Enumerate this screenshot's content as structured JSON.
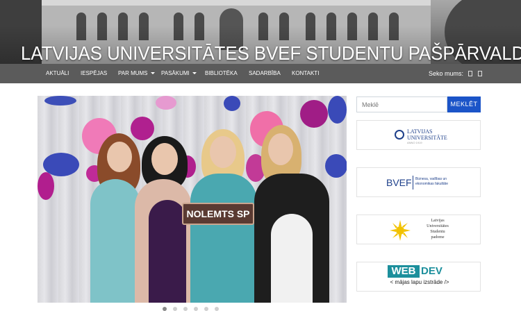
{
  "header": {
    "title": "LATVIJAS UNIVERSITĀTES BVEF STUDENTU PAŠPĀRVALDE"
  },
  "nav": {
    "items": [
      {
        "label": "AKTUĀLI",
        "dropdown": false
      },
      {
        "label": "IESPĒJAS",
        "dropdown": false
      },
      {
        "label": "PAR MUMS",
        "dropdown": true
      },
      {
        "label": "PASĀKUMI",
        "dropdown": true
      },
      {
        "label": "BIBLIOTĒKA",
        "dropdown": false
      },
      {
        "label": "SADARBĪBA",
        "dropdown": false
      },
      {
        "label": "KONTAKTI",
        "dropdown": false
      }
    ],
    "follow_label": "Seko mums:"
  },
  "slider": {
    "sign_text": "NOLEMTS SP",
    "slide_count": 6,
    "active_slide": 1
  },
  "search": {
    "placeholder": "Meklē",
    "button_label": "MEKLĒT"
  },
  "sponsors": {
    "lu": {
      "line1": "LATVIJAS",
      "line2": "UNIVERSITĀTE",
      "sub": "ANNO 1919"
    },
    "bvef": {
      "abbr": "BVEF",
      "sub": "Biznesa, vadības un\nekonomikas fakultāte"
    },
    "sp": {
      "text": "Latvijas\nUniversitātes\nStudentu\npadome"
    },
    "webdev": {
      "web": "WEB",
      "dev": "DEV",
      "sub": "< mājas lapu izstrāde />"
    }
  },
  "colors": {
    "nav_bg": "#5b5b5b",
    "search_button": "#1b54c8",
    "lu_blue": "#1d3f8a",
    "webdev_teal": "#1c8f9c"
  }
}
